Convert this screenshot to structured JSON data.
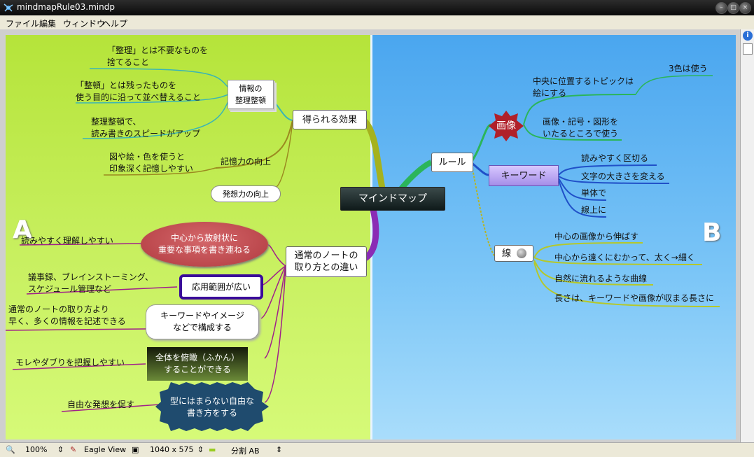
{
  "window": {
    "title": "mindmapRule03.mindp"
  },
  "menu": [
    "ファイル",
    "編集",
    "ウィンドウ",
    "ヘルプ"
  ],
  "colors": {
    "paneA": "#c8f060",
    "paneB": "#7cc6f7",
    "center_node": "#1f2a2a",
    "keyword_node": "#b9a7f0"
  },
  "panes": {
    "a": "A",
    "b": "B"
  },
  "mindmap": {
    "center": "マインドマップ",
    "effects": {
      "label": "得られる効果",
      "organize": {
        "label": "情報の\n整理整頓",
        "items": [
          "「整理」とは不要なものを\n捨てること",
          "「整頓」とは残ったものを\n使う目的に沿って並べ替えること",
          "整理整頓で、\n読み書きのスピードがアップ"
        ]
      },
      "memory": {
        "label": "記憶力の向上",
        "detail": "図や絵・色を使うと\n印象深く記憶しやすい"
      },
      "ideas": {
        "label": "発想力の向上"
      }
    },
    "diff": {
      "label": "通常のノートの\n取り方との違い",
      "radial": {
        "label": "中心から放射状に\n重要な事項を書き連ねる",
        "detail": "読みやすく理解しやすい"
      },
      "apps": {
        "label": "応用範囲が広い",
        "detail": "議事録、ブレインストーミング、\nスケジュール管理など"
      },
      "keywords": {
        "label": "キーワードやイメージ\nなどで構成する",
        "detail": "通常のノートの取り方より\n早く、多くの情報を記述できる"
      },
      "overview": {
        "label": "全体を俯瞰（ふかん）\nすることができる",
        "detail": "モレやダブりを把握しやすい"
      },
      "free": {
        "label": "型にはまらない自由な\n書き方をする",
        "detail": "自由な発想を促す"
      }
    },
    "rules": {
      "label": "ルール",
      "image": {
        "label": "画像",
        "items": [
          "中央に位置するトピックは\n絵にする",
          "画像・記号・図形を\nいたるところで使う"
        ],
        "sub": "3色は使う"
      },
      "keyword": {
        "label": "キーワード",
        "items": [
          "読みやすく区切る",
          "文字の大きさを変える",
          "単体で",
          "線上に"
        ]
      },
      "line": {
        "label": "線",
        "items": [
          "中心の画像から伸ばす",
          "中心から遠くにむかって、太く→細く",
          "自然に流れるような曲線",
          "長さは、キーワードや画像が収まる長さに"
        ]
      }
    }
  },
  "statusbar": {
    "zoom": "100%",
    "view": "Eagle View",
    "size": "1040 x 575",
    "split": "分割 AB"
  }
}
